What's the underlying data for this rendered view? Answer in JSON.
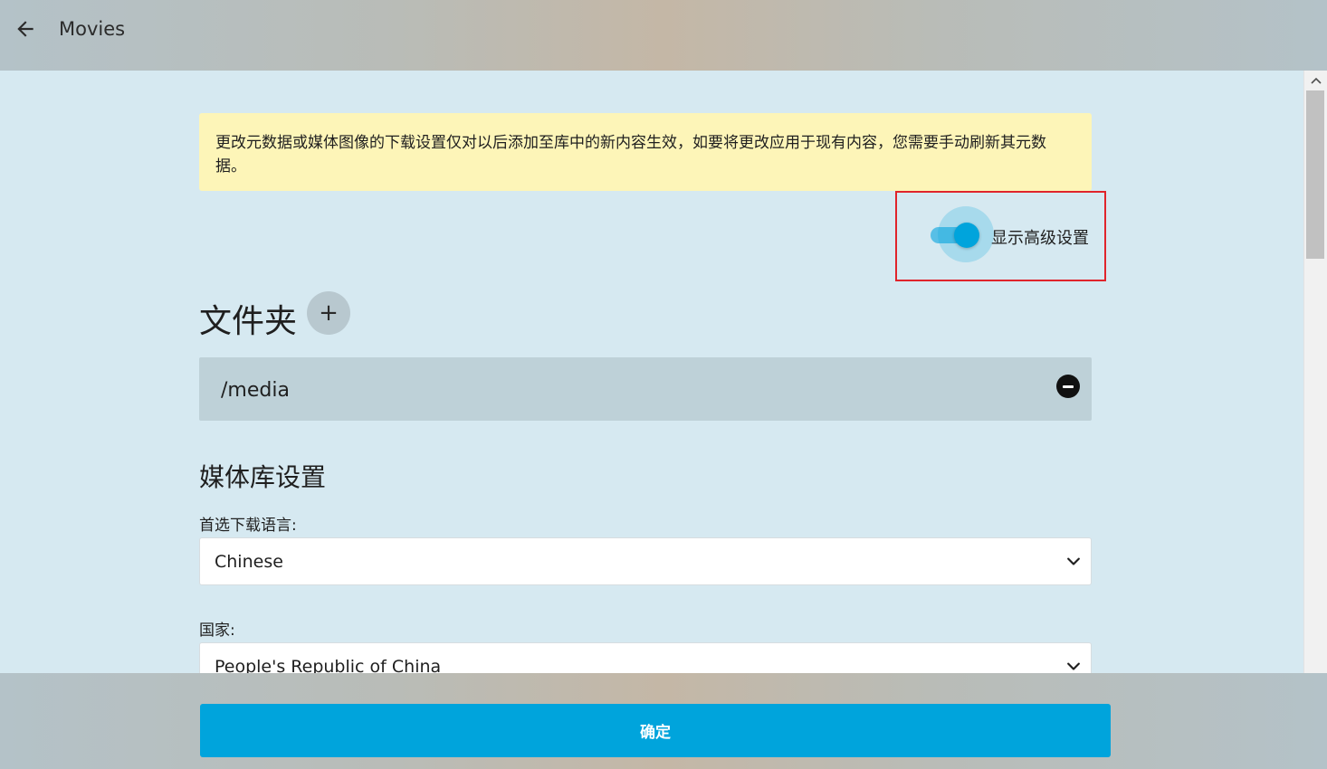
{
  "header": {
    "title": "Movies",
    "back_icon": "arrow-left-icon"
  },
  "notice": {
    "text": "更改元数据或媒体图像的下载设置仅对以后添加至库中的新内容生效，如要将更改应用于现有内容，您需要手动刷新其元数据。"
  },
  "advanced": {
    "label": "显示高级设置",
    "enabled": true
  },
  "folders": {
    "title": "文件夹",
    "add_label": "+",
    "items": [
      {
        "path": "/media"
      }
    ]
  },
  "library_settings": {
    "title": "媒体库设置",
    "language": {
      "label": "首选下载语言:",
      "value": "Chinese"
    },
    "country": {
      "label": "国家:",
      "value": "People's Republic of China"
    }
  },
  "footer": {
    "confirm_label": "确定"
  },
  "colors": {
    "accent": "#00a4dc",
    "notice_bg": "#fdf5b8",
    "highlight_border": "#e0242b"
  }
}
